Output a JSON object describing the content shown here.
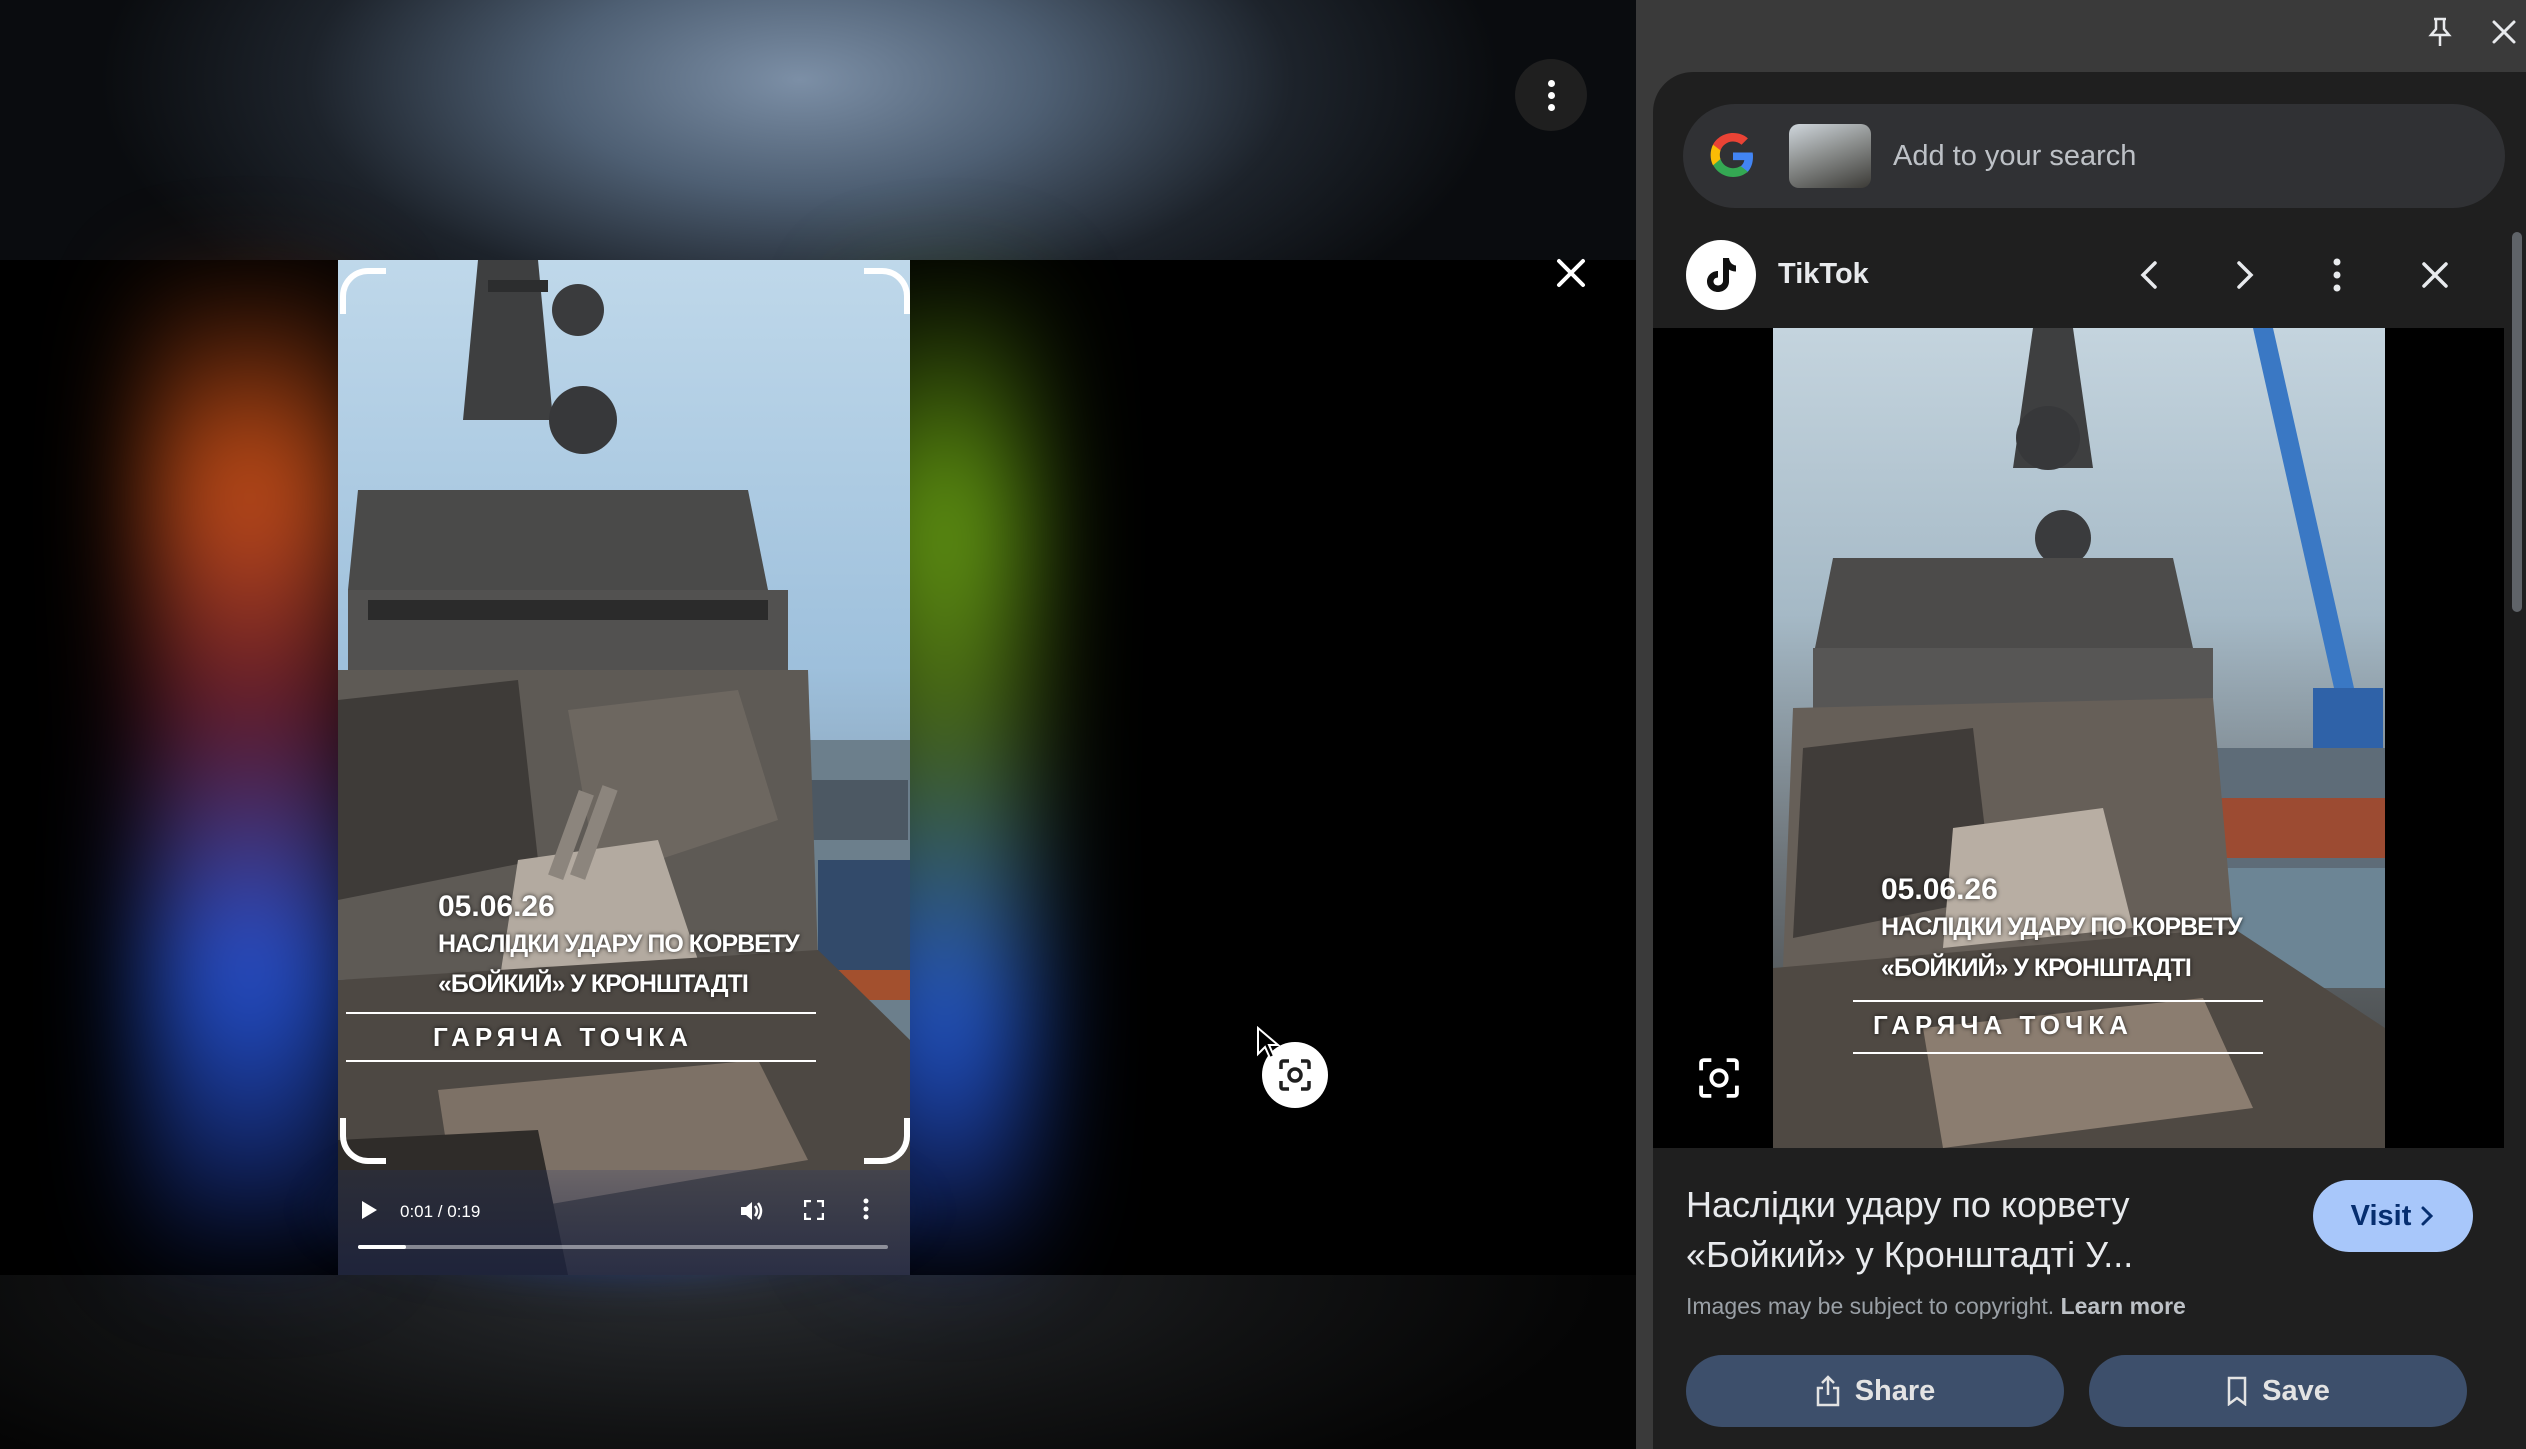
{
  "viewer": {
    "video": {
      "date": "05.06.26",
      "caption_line1": "НАСЛІДКИ УДАРУ ПО КОРВЕТУ",
      "caption_line2": "«БОЙКИЙ» У КРОНШТАДТІ",
      "brand": "ГАРЯЧА ТОЧКА",
      "time": "0:01 / 0:19",
      "progress": 0.09
    }
  },
  "side_panel": {
    "search": {
      "placeholder": "Add to your search"
    },
    "source": {
      "name": "TikTok"
    },
    "preview": {
      "date": "05.06.26",
      "caption_line1": "НАСЛІДКИ УДАРУ ПО КОРВЕТУ",
      "caption_line2": "«БОЙКИЙ» У КРОНШТАДТІ",
      "brand": "ГАРЯЧА ТОЧКА"
    },
    "result": {
      "title": "Наслідки удару по корвету «Бойкий» у Кронштадті У...",
      "visit_label": "Visit",
      "copyright_text": "Images may be subject to copyright.",
      "learn_more": "Learn more"
    },
    "actions": {
      "share_label": "Share",
      "save_label": "Save"
    }
  },
  "colors": {
    "panel_bg": "#1f1f1f",
    "outer_bg": "#3a3a3a",
    "visit_bg": "#a8c7fa",
    "action_bg": "#3d4f6b"
  }
}
